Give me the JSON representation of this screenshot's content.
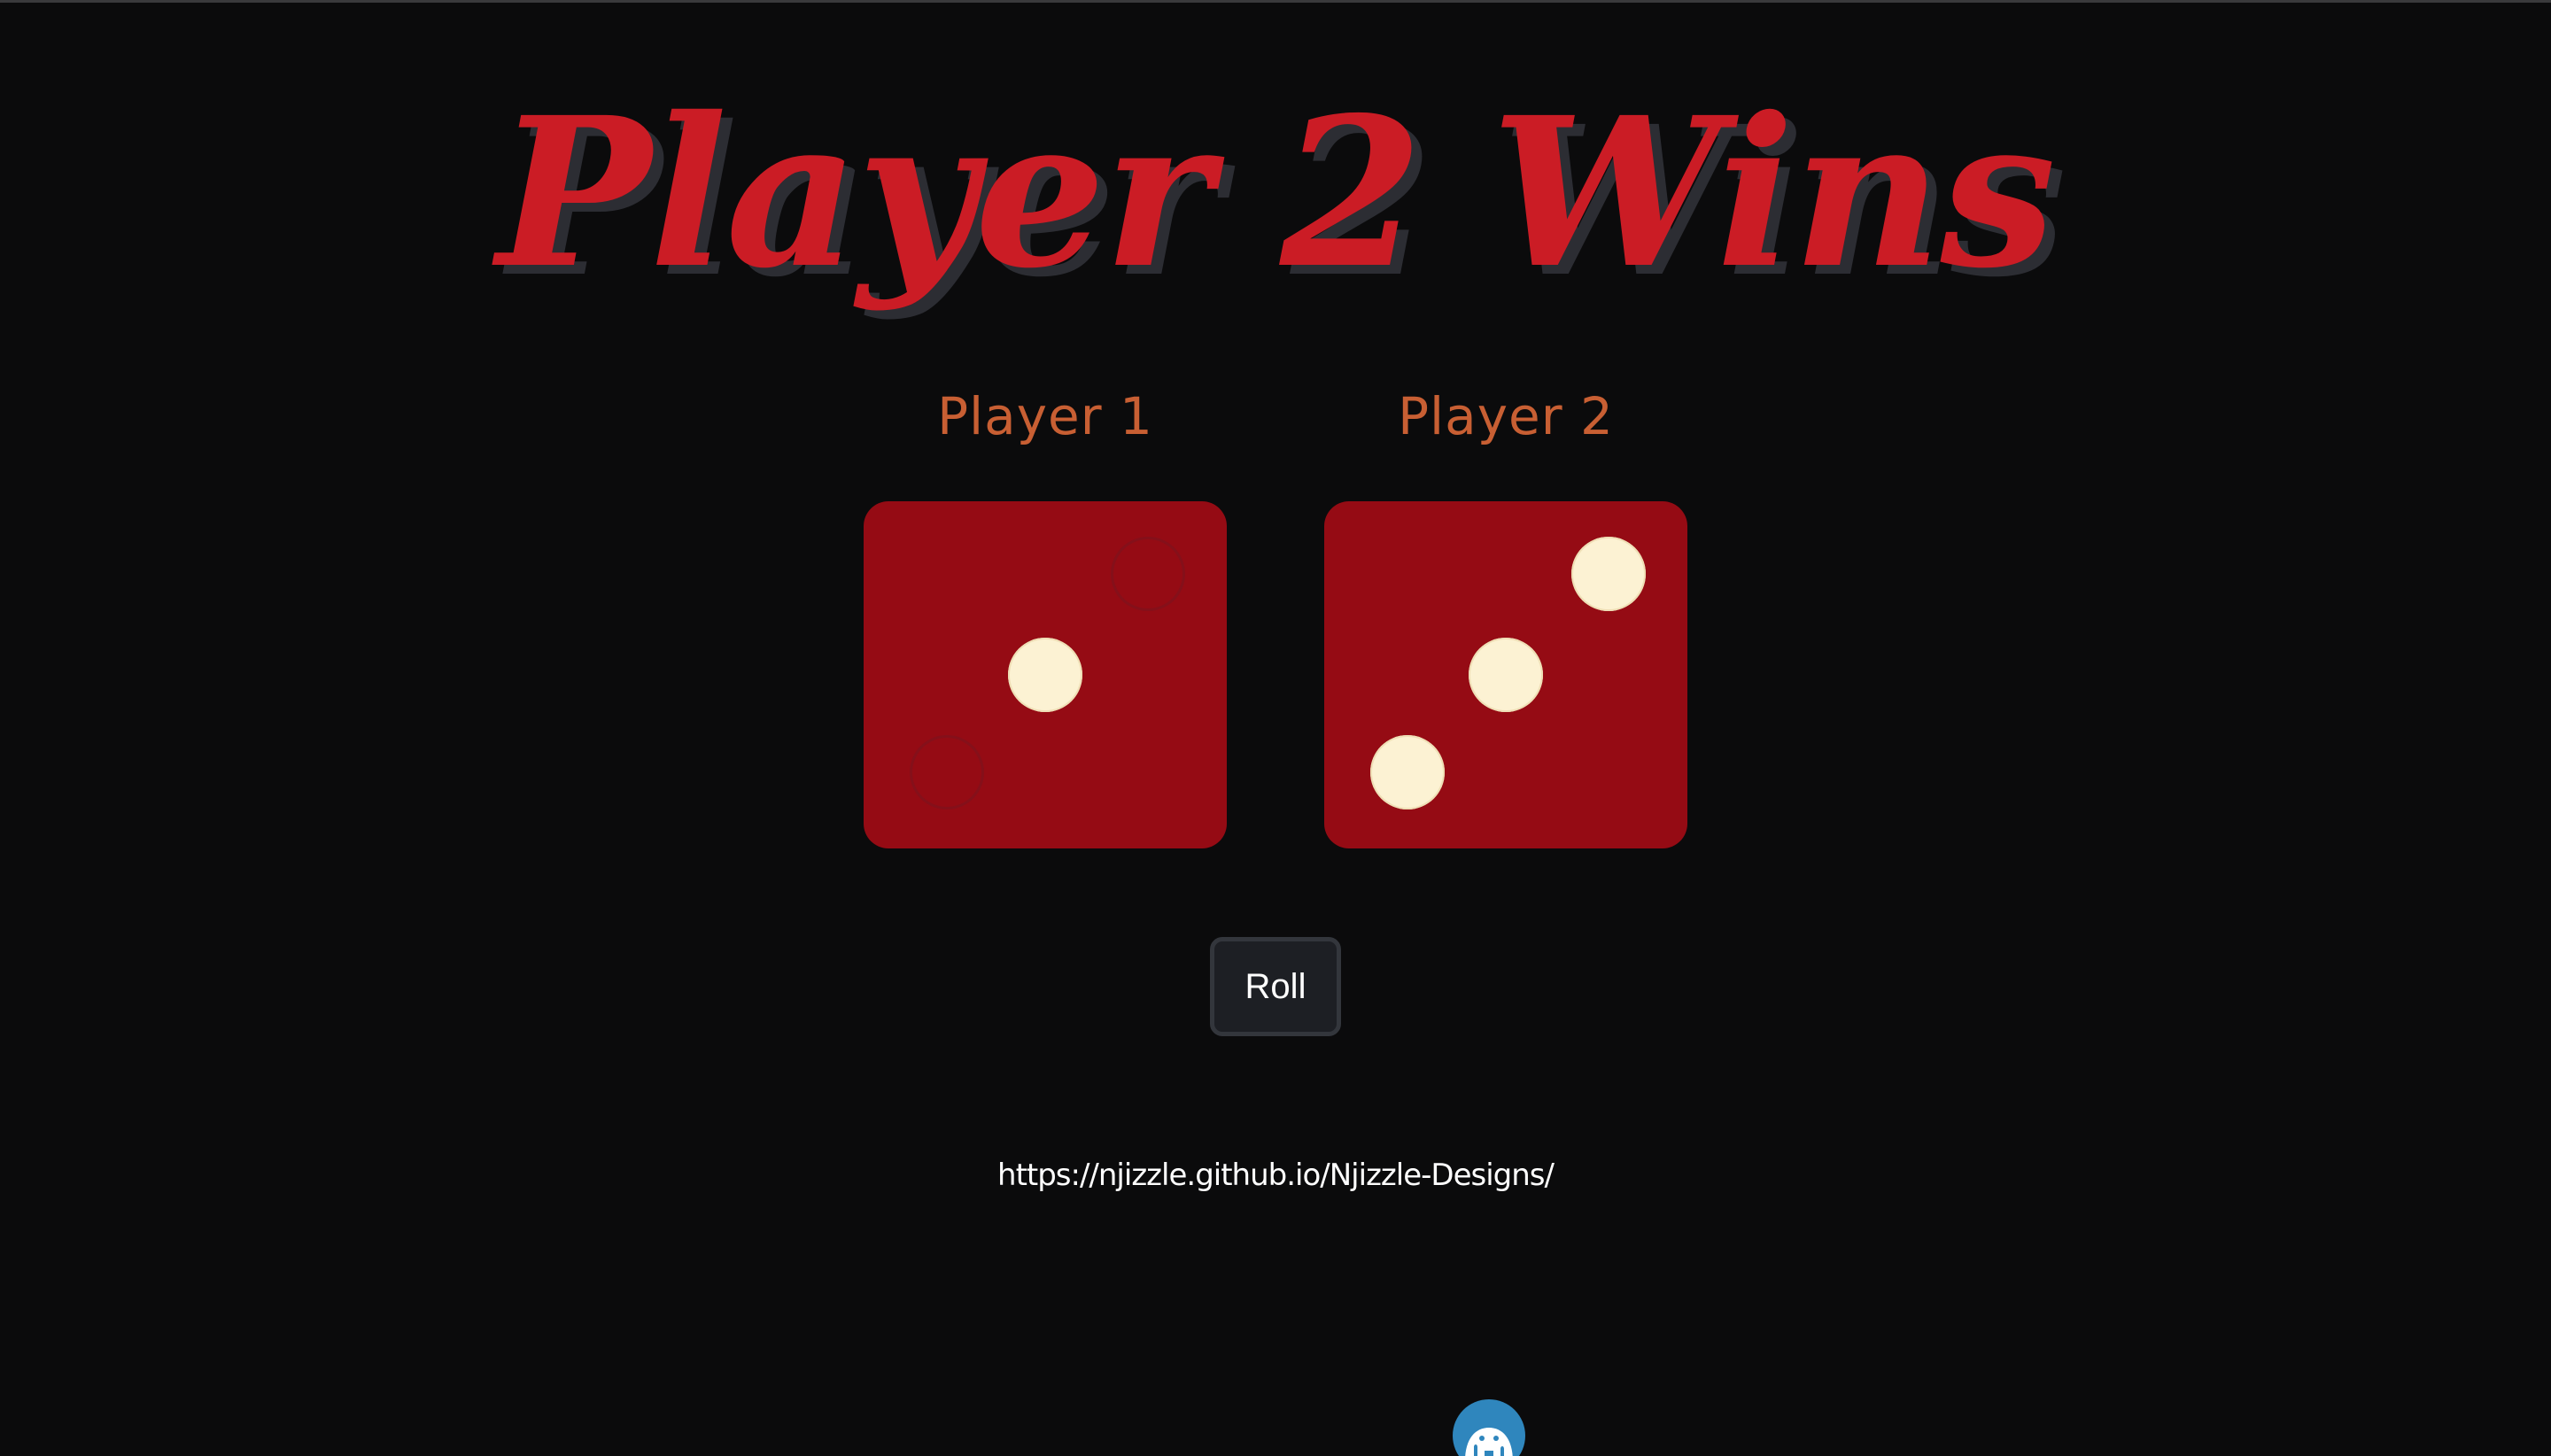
{
  "title": "Player 2 Wins",
  "players": [
    {
      "label": "Player 1",
      "die_value": 1
    },
    {
      "label": "Player 2",
      "die_value": 3
    }
  ],
  "roll_button": {
    "label": "Roll"
  },
  "credit_link": {
    "text": "https://njizzle.github.io/Njizzle-Designs/"
  },
  "colors": {
    "background": "#0b0b0c",
    "title": "#cb1c25",
    "title_shadow": "#2c2d33",
    "player_label": "#c85f33",
    "die_face": "#950b14",
    "pip": "#fcf2d3",
    "button_bg": "#1d1f24",
    "badge": "#2f86bd"
  },
  "icons": {
    "badge": "elephant-icon"
  }
}
